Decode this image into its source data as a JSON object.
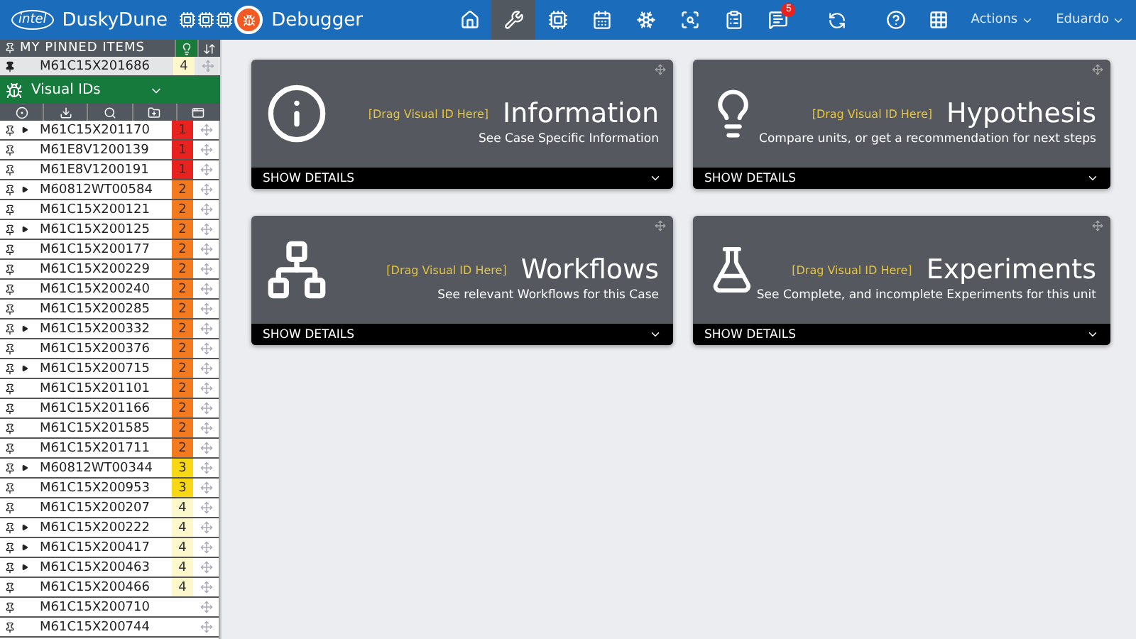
{
  "topbar": {
    "logo": "intel",
    "app_name": "DuskyDune",
    "page_title": "Debugger",
    "nav": [
      {
        "kind": "home",
        "selected": false
      },
      {
        "kind": "tools",
        "selected": true
      },
      {
        "kind": "chip",
        "selected": false
      },
      {
        "kind": "calendar",
        "selected": false
      },
      {
        "kind": "cluster",
        "selected": false
      },
      {
        "kind": "inspect",
        "selected": false
      },
      {
        "kind": "clipboard",
        "selected": false
      },
      {
        "kind": "messages",
        "selected": false,
        "badge": "5"
      }
    ],
    "menus": [
      {
        "label": "Actions"
      },
      {
        "label": "Eduardo"
      }
    ]
  },
  "sidebar": {
    "pinned": {
      "title": "MY PINNED ITEMS",
      "items": [
        {
          "id": "M61C15X201686",
          "priority": "4",
          "color": "#fdf7cc"
        }
      ]
    },
    "group": {
      "title": "Visual IDs"
    },
    "rows": [
      {
        "id": "M61C15X201170",
        "expandable": true,
        "priority": "1",
        "color": "#e8221f"
      },
      {
        "id": "M61E8V1200139",
        "expandable": false,
        "priority": "1",
        "color": "#e8221f"
      },
      {
        "id": "M61E8V1200191",
        "expandable": false,
        "priority": "1",
        "color": "#e8221f"
      },
      {
        "id": "M60812WT00584",
        "expandable": true,
        "priority": "2",
        "color": "#f47a20"
      },
      {
        "id": "M61C15X200121",
        "expandable": false,
        "priority": "2",
        "color": "#f47a20"
      },
      {
        "id": "M61C15X200125",
        "expandable": true,
        "priority": "2",
        "color": "#f47a20"
      },
      {
        "id": "M61C15X200177",
        "expandable": false,
        "priority": "2",
        "color": "#f47a20"
      },
      {
        "id": "M61C15X200229",
        "expandable": false,
        "priority": "2",
        "color": "#f47a20"
      },
      {
        "id": "M61C15X200240",
        "expandable": false,
        "priority": "2",
        "color": "#f47a20"
      },
      {
        "id": "M61C15X200285",
        "expandable": false,
        "priority": "2",
        "color": "#f47a20"
      },
      {
        "id": "M61C15X200332",
        "expandable": true,
        "priority": "2",
        "color": "#f47a20"
      },
      {
        "id": "M61C15X200376",
        "expandable": false,
        "priority": "2",
        "color": "#f47a20"
      },
      {
        "id": "M61C15X200715",
        "expandable": true,
        "priority": "2",
        "color": "#f47a20"
      },
      {
        "id": "M61C15X201101",
        "expandable": false,
        "priority": "2",
        "color": "#f47a20"
      },
      {
        "id": "M61C15X201166",
        "expandable": false,
        "priority": "2",
        "color": "#f47a20"
      },
      {
        "id": "M61C15X201585",
        "expandable": false,
        "priority": "2",
        "color": "#f47a20"
      },
      {
        "id": "M61C15X201711",
        "expandable": false,
        "priority": "2",
        "color": "#f47a20"
      },
      {
        "id": "M60812WT00344",
        "expandable": true,
        "priority": "3",
        "color": "#f8d814"
      },
      {
        "id": "M61C15X200953",
        "expandable": false,
        "priority": "3",
        "color": "#f8d814"
      },
      {
        "id": "M61C15X200207",
        "expandable": false,
        "priority": "4",
        "color": "#fdf7cc"
      },
      {
        "id": "M61C15X200222",
        "expandable": true,
        "priority": "4",
        "color": "#fdf7cc"
      },
      {
        "id": "M61C15X200417",
        "expandable": true,
        "priority": "4",
        "color": "#fdf7cc"
      },
      {
        "id": "M61C15X200463",
        "expandable": true,
        "priority": "4",
        "color": "#fdf7cc"
      },
      {
        "id": "M61C15X200466",
        "expandable": false,
        "priority": "4",
        "color": "#fdf7cc"
      },
      {
        "id": "M61C15X200710",
        "expandable": false
      },
      {
        "id": "M61C15X200744",
        "expandable": false
      }
    ]
  },
  "cards": [
    {
      "kind": "info",
      "title": "Information",
      "drop_hint": "[Drag Visual ID Here]",
      "subtitle": "See Case Specific Information",
      "footer": "SHOW DETAILS"
    },
    {
      "kind": "hypothesis",
      "title": "Hypothesis",
      "drop_hint": "[Drag Visual ID Here]",
      "subtitle": "Compare units, or get a recommendation for next steps",
      "footer": "SHOW DETAILS"
    },
    {
      "kind": "workflow",
      "title": "Workflows",
      "drop_hint": "[Drag Visual ID Here]",
      "subtitle": "See relevant Workflows for this Case",
      "footer": "SHOW DETAILS"
    },
    {
      "kind": "experiment",
      "title": "Experiments",
      "drop_hint": "[Drag Visual ID Here]",
      "subtitle": "See Complete, and incomplete Experiments for this unit",
      "footer": "SHOW DETAILS"
    }
  ]
}
